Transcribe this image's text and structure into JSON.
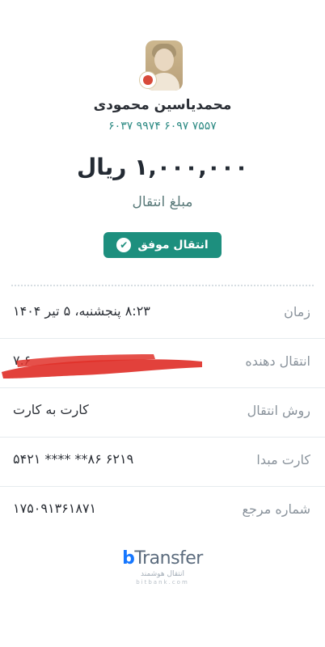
{
  "recipient": {
    "name": "محمدیاسین محمودی",
    "card_number": "۶۰۳۷ ۹۹۷۴ ۶۰۹۷ ۷۵۵۷"
  },
  "transfer": {
    "amount": "۱,۰۰۰,۰۰۰ ریال",
    "amount_label": "مبلغ انتقال",
    "status": "انتقال موفق"
  },
  "details": [
    {
      "label": "زمان",
      "value": "۸:۲۳ پنجشنبه، ۵ تیر ۱۴۰۴"
    },
    {
      "label": "انتقال دهنده",
      "value": "۷.۶"
    },
    {
      "label": "روش انتقال",
      "value": "کارت به کارت"
    },
    {
      "label": "کارت مبدا",
      "value": "۶۲۱۹ ۸۶** **** ۵۴۲۱"
    },
    {
      "label": "شماره مرجع",
      "value": "۱۷۵۰۹۱۳۶۱۸۷۱"
    }
  ],
  "logo": {
    "brand_b": "b",
    "brand_rest": "Transfer",
    "tagline": "انتقال هوشمند",
    "domain": "bitbank.com"
  },
  "icons": {
    "avatar": "user-avatar-icon",
    "bank": "bank-emblem-icon",
    "success": "check-circle-icon"
  },
  "colors": {
    "accent": "#1d8f7e",
    "redaction": "#e0312a"
  }
}
